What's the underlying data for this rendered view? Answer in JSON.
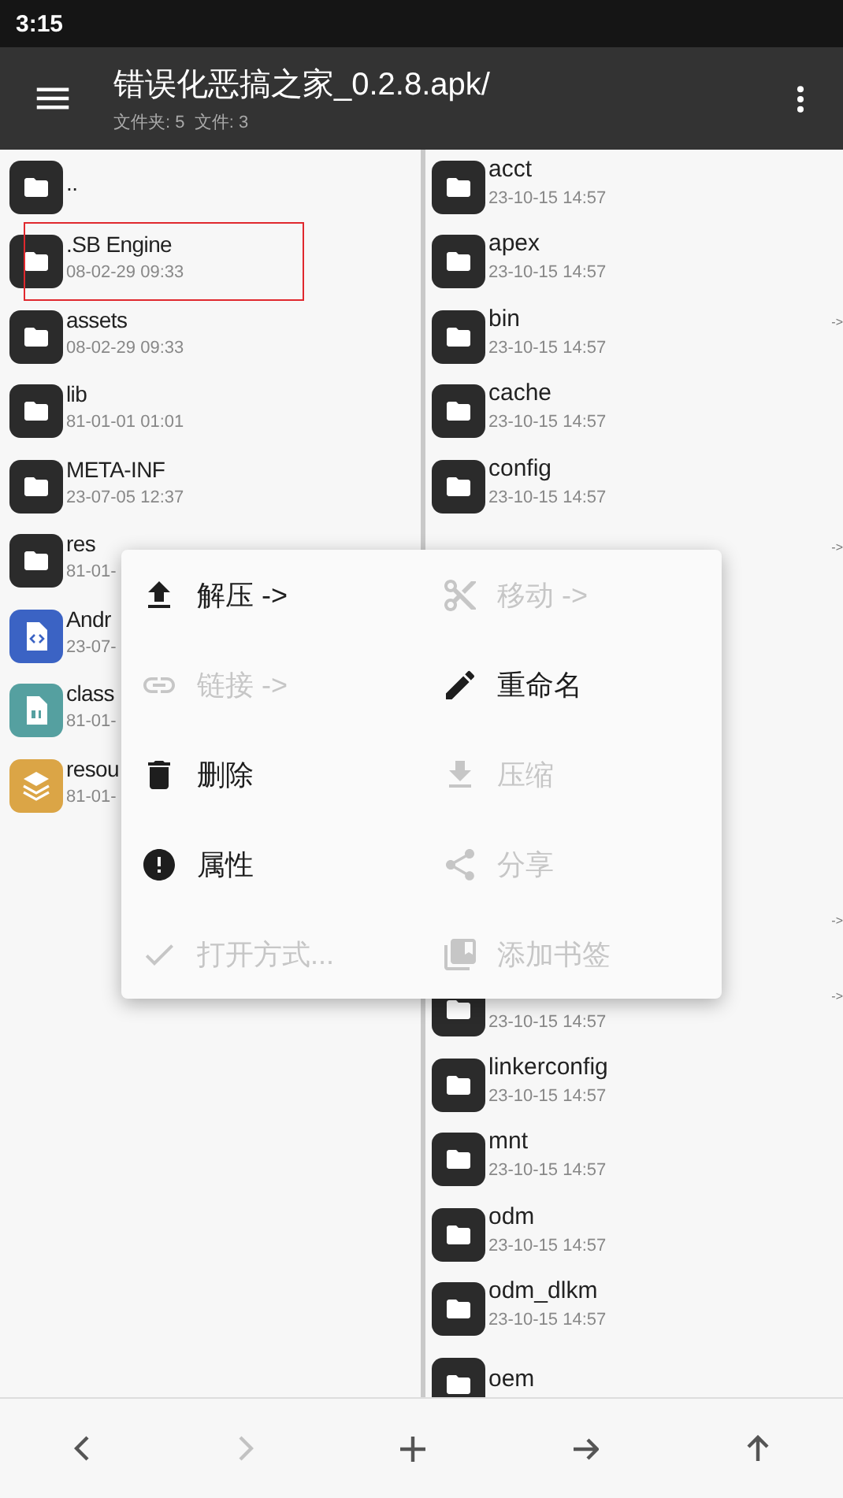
{
  "status_bar": {
    "time": "3:15"
  },
  "app_bar": {
    "title": "错误化恶搞之家_0.2.8.apk/",
    "subtitle": "文件夹: 5  文件: 3"
  },
  "left_pane": {
    "rows": [
      {
        "kind": "folder",
        "color": "#2b2b2b",
        "name": "..",
        "highlighted": false
      },
      {
        "kind": "folder",
        "color": "#2b2b2b",
        "name": ".SB Engine",
        "date": "08-02-29 09:33",
        "highlighted": true
      },
      {
        "kind": "folder",
        "color": "#2b2b2b",
        "name": "assets",
        "date": "08-02-29 09:33",
        "highlighted": false
      },
      {
        "kind": "folder",
        "color": "#2b2b2b",
        "name": "lib",
        "date": "81-01-01 01:01",
        "highlighted": false
      },
      {
        "kind": "folder",
        "color": "#2b2b2b",
        "name": "META-INF",
        "date": "23-07-05 12:37",
        "highlighted": false
      },
      {
        "kind": "folder",
        "color": "#2b2b2b",
        "name": "res",
        "date": "81-01-",
        "highlighted": false
      },
      {
        "kind": "code",
        "color": "#3b63c4",
        "name": "Andr",
        "date": "23-07-",
        "highlighted": false
      },
      {
        "kind": "binary",
        "color": "#55a0a0",
        "name": "class",
        "date": "81-01-",
        "highlighted": false
      },
      {
        "kind": "layers",
        "color": "#dba546",
        "name": "resou",
        "date": "81-01-",
        "highlighted": false
      }
    ]
  },
  "right_pane": {
    "rows": [
      {
        "name": "acct",
        "date": "23-10-15 14:57"
      },
      {
        "name": "apex",
        "date": "23-10-15 14:57"
      },
      {
        "name": "bin",
        "date": "23-10-15 14:57",
        "link": "->"
      },
      {
        "name": "cache",
        "date": "23-10-15 14:57"
      },
      {
        "name": "config",
        "date": "23-10-15 14:57"
      },
      {
        "link": "->"
      },
      {},
      {},
      {},
      {},
      {
        "link": "->"
      },
      {
        "date": "23-10-15 14:57",
        "link": "->"
      },
      {
        "name": "linkerconfig",
        "date": "23-10-15 14:57"
      },
      {
        "name": "mnt",
        "date": "23-10-15 14:57"
      },
      {
        "name": "odm",
        "date": "23-10-15 14:57"
      },
      {
        "name": "odm_dlkm",
        "date": "23-10-15 14:57"
      },
      {
        "name": "oem"
      }
    ]
  },
  "context_menu": {
    "items": [
      {
        "label": "解压 ->",
        "disabled": false
      },
      {
        "label": "移动 ->",
        "disabled": true
      },
      {
        "label": "链接 ->",
        "disabled": true
      },
      {
        "label": "重命名",
        "disabled": false
      },
      {
        "label": "删除",
        "disabled": false
      },
      {
        "label": "压缩",
        "disabled": true
      },
      {
        "label": "属性",
        "disabled": false
      },
      {
        "label": "分享",
        "disabled": true
      },
      {
        "label": "打开方式...",
        "disabled": true
      },
      {
        "label": "添加书签",
        "disabled": true
      }
    ]
  },
  "toolbar": [
    {
      "kind": "back",
      "disabled": false
    },
    {
      "kind": "forward",
      "disabled": true
    },
    {
      "kind": "add",
      "disabled": false
    },
    {
      "kind": "go",
      "disabled": false
    },
    {
      "kind": "up",
      "disabled": false
    }
  ]
}
